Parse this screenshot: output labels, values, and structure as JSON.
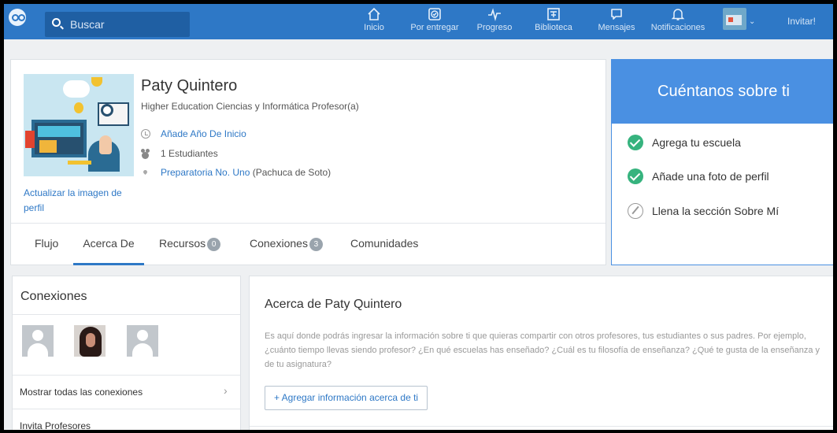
{
  "nav": {
    "search_placeholder": "Buscar",
    "items": [
      {
        "label": "Inicio",
        "icon": "home-icon"
      },
      {
        "label": "Por entregar",
        "icon": "assignment-icon"
      },
      {
        "label": "Progreso",
        "icon": "progress-icon"
      },
      {
        "label": "Biblioteca",
        "icon": "library-icon"
      },
      {
        "label": "Mensajes",
        "icon": "message-icon"
      },
      {
        "label": "Notificaciones",
        "icon": "bell-icon"
      }
    ],
    "invite": "Invitar!",
    "colors": {
      "bar": "#2e78c6",
      "accent": "#4a90e2",
      "done": "#36b37e"
    }
  },
  "profile": {
    "name": "Paty Quintero",
    "subtitle": "Higher Education Ciencias y Informática Profesor(a)",
    "start_year": "Añade Año De Inicio",
    "students": "1 Estudiantes",
    "school_link": "Preparatoria No. Uno",
    "school_location": " (Pachuca de Soto)",
    "update_image": "Actualizar la imagen de perfil"
  },
  "tabs": [
    {
      "label": "Flujo"
    },
    {
      "label": "Acerca De",
      "active": true
    },
    {
      "label": "Recursos",
      "badge": "0"
    },
    {
      "label": "Conexiones",
      "badge": "3"
    },
    {
      "label": "Comunidades"
    }
  ],
  "tell_us": {
    "title": "Cuéntanos sobre ti",
    "items": [
      {
        "label": "Agrega tu escuela",
        "done": true
      },
      {
        "label": "Añade una foto de perfil",
        "done": true
      },
      {
        "label": "Llena la sección Sobre Mí",
        "done": false
      }
    ]
  },
  "connections": {
    "title": "Conexiones",
    "show_all": "Mostrar todas las conexiones",
    "invite": "Invita Profesores"
  },
  "about": {
    "title": "Acerca de Paty Quintero",
    "description": "Es aquí donde podrás ingresar la información sobre ti que quieras compartir con otros profesores, tus estudiantes o sus padres. Por ejemplo, ¿cuánto tiempo llevas siendo profesor? ¿En qué escuelas has enseñado? ¿Cuál es tu filosofía de enseñanza? ¿Qué te gusta de la enseñanza y de tu asignatura?",
    "add_button": "+ Agregar información acerca de ti"
  }
}
